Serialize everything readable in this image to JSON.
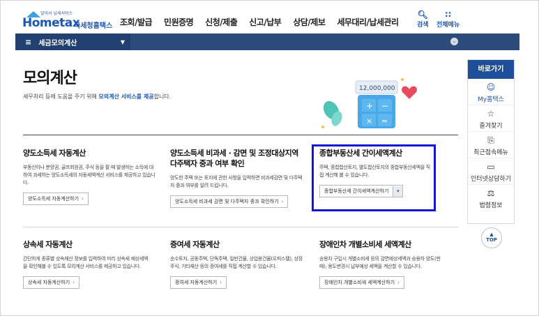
{
  "header": {
    "logo_tagline": "알아서 납세서비스",
    "logo_main": "Hometax",
    "logo_sub": "국세청홈택스",
    "gnb": [
      "조회/발급",
      "민원증명",
      "신청/제출",
      "신고/납부",
      "상담/제보",
      "세무대리/납세관리"
    ],
    "search_label": "검색",
    "allmenu_label": "전체메뉴"
  },
  "navbar": {
    "menu_label": "세금모의계산"
  },
  "main": {
    "title": "모의계산",
    "desc_pre": "세무처리 등에 도움을 주기 위해 ",
    "desc_hl": "모의계산 서비스를 제공",
    "desc_post": "합니다.",
    "hero_amount": "12,000,000"
  },
  "cards": [
    {
      "title": "양도소득세 자동계산",
      "desc": "부동산이나 분양권, 골프회원권, 주식 등을 팔 때 발생하는 소득에 대하여 과세하는 양도소득세의 자동세액계산 서비스를 제공하고 있습니다.",
      "button": "양도소득세 자동계산하기"
    },
    {
      "title": "양도소득세 비과세 · 감면 및 조정대상지역 다주택자 중과 여부 확인",
      "desc": "양도한 주택 또는 토지에 관한 사항을 입력하면 비과세감면 및 다주택자 중과 여부를 알려 드립니다.",
      "button": "양도소득세 비과세 감면 및 다주택자 중과 확인하기"
    },
    {
      "title": "종합부동산세 간이세액계산",
      "desc": "주택, 종합합산토지, 별도합산토지의 종합부동산세액을 직접 계산해 볼 수 있습니다.",
      "button": "종합부동산세 간이세액계산하기"
    },
    {
      "title": "상속세 자동계산",
      "desc": "간단하게 종류별 상속재산 정보를 입력하여 미리 상속세 예상세액을 확인해볼 수 있도록 모의계산 서비스를 제공하고 있습니다.",
      "button": "상속세 자동계산하기"
    },
    {
      "title": "증여세 자동계산",
      "desc": "순수토지, 공동주택, 단독주택, 일반건물, 상업용건물(오피스텔), 상장주식, 기타재산 등의 증여세를 직접 계산할 수 있습니다.",
      "button": "증여세 자동계산하기"
    },
    {
      "title": "장애인차 개별소비세 세액계산",
      "desc": "승용차 구입시 개별소비세 등의 감면예상세액과 승용차 양도(판매), 용도변경시 납부예상 세액을 계산할 수 있습니다.",
      "button": "장애인차 개별소비세 세액계산하기"
    }
  ],
  "quick": {
    "title": "바로가기",
    "items": [
      {
        "label": "My홈택스",
        "icon": "person-icon"
      },
      {
        "label": "즐겨찾기",
        "icon": "star-icon"
      },
      {
        "label": "최근접속메뉴",
        "icon": "recent-menu-icon"
      },
      {
        "label": "인터넷상담하기",
        "icon": "monitor-icon"
      },
      {
        "label": "법령정보",
        "icon": "gavel-icon"
      }
    ],
    "top_label": "TOP"
  },
  "colors": {
    "brand": "#1d56b5",
    "navbar": "#2c4a7a",
    "highlight": "#1414d8"
  }
}
